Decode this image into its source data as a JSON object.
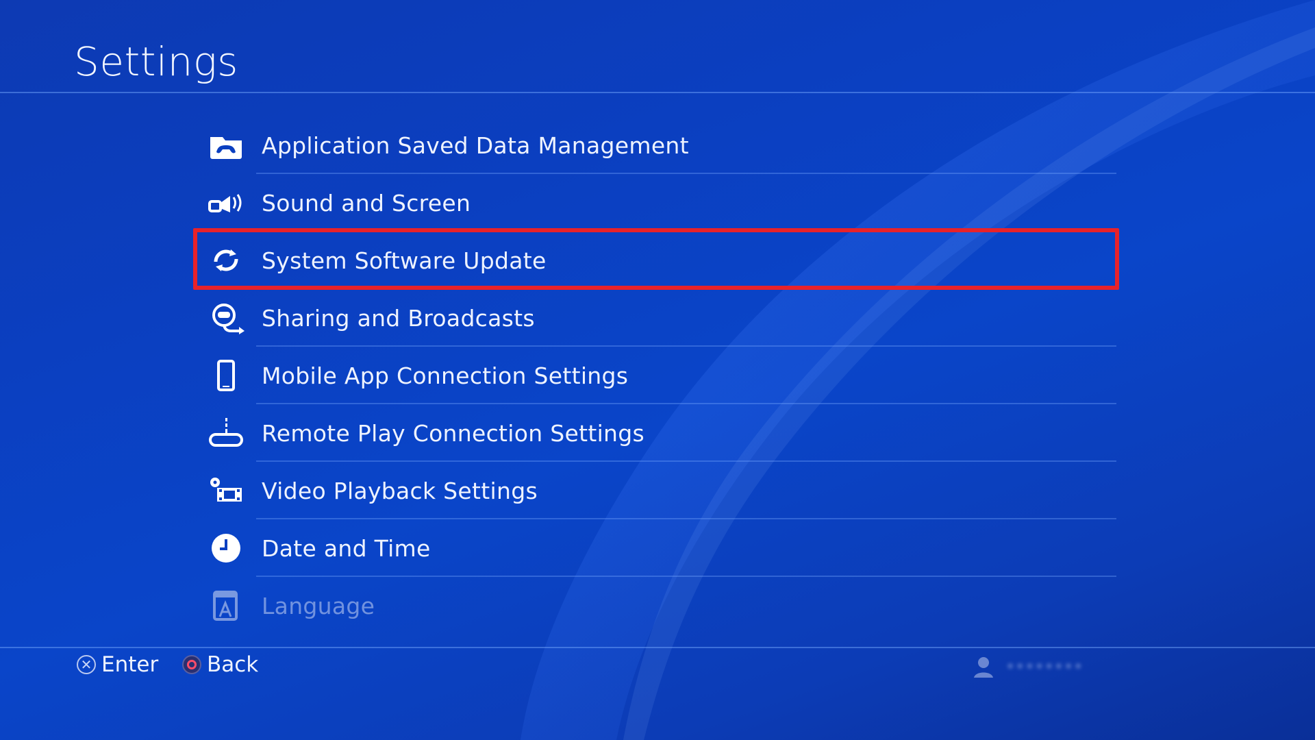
{
  "header": {
    "title": "Settings"
  },
  "menu": {
    "items": [
      {
        "label": "Application Saved Data Management",
        "icon": "saved-data-icon"
      },
      {
        "label": "Sound and Screen",
        "icon": "sound-screen-icon"
      },
      {
        "label": "System Software Update",
        "icon": "update-icon",
        "highlighted": true
      },
      {
        "label": "Sharing and Broadcasts",
        "icon": "sharing-icon"
      },
      {
        "label": "Mobile App Connection Settings",
        "icon": "mobile-icon"
      },
      {
        "label": "Remote Play Connection Settings",
        "icon": "remote-play-icon"
      },
      {
        "label": "Video Playback Settings",
        "icon": "video-playback-icon"
      },
      {
        "label": "Date and Time",
        "icon": "clock-icon"
      },
      {
        "label": "Language",
        "icon": "language-icon"
      }
    ]
  },
  "footer": {
    "enter_label": "Enter",
    "back_label": "Back",
    "user_name": "••••••••"
  },
  "colors": {
    "highlight": "#e8222a",
    "background": "#0b3fc0"
  }
}
